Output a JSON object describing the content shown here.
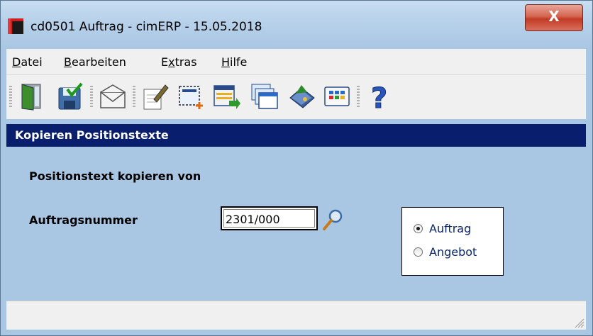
{
  "window": {
    "title": "cd0501 Auftrag - cimERP - 15.05.2018",
    "close_label": "X"
  },
  "menu": [
    {
      "label": "Datei",
      "u": "D",
      "rest": "atei"
    },
    {
      "label": "Bearbeiten",
      "u": "B",
      "rest": "earbeiten"
    },
    {
      "label": "Extras",
      "pre": "E",
      "u": "x",
      "rest": "tras"
    },
    {
      "label": "Hilfe",
      "u": "H",
      "rest": "ilfe"
    }
  ],
  "toolbar": {
    "buttons": [
      "exit-icon",
      "save-icon",
      "mail-icon",
      "edit-icon",
      "new-position-icon",
      "import-list-icon",
      "windows-icon",
      "book-icon",
      "grid-icon",
      "help-icon"
    ]
  },
  "section": {
    "header": "Kopieren Positionstexte"
  },
  "form": {
    "heading": "Positionstext kopieren von",
    "order_label": "Auftragsnummer",
    "order_value": "2301/000",
    "options": [
      {
        "label": "Auftrag",
        "selected": true
      },
      {
        "label": "Angebot",
        "selected": false
      }
    ]
  },
  "colors": {
    "header_bg": "#0a1e6e",
    "content_bg": "#a9c6e2",
    "close_red": "#c23b25"
  }
}
